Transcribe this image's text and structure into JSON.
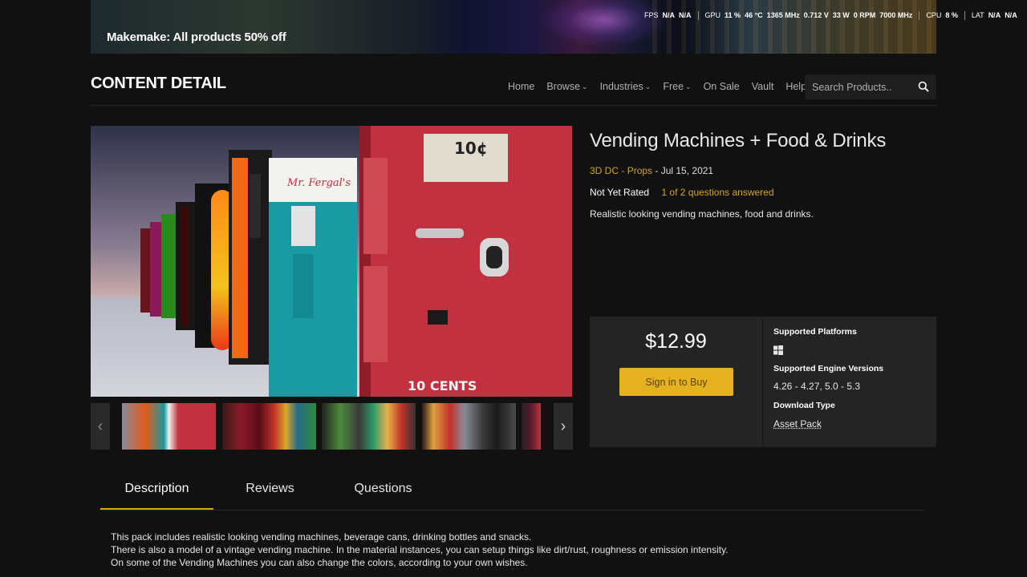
{
  "banner": {
    "text": "Makemake: All products 50% off"
  },
  "perf": {
    "fps_label": "FPS",
    "fps_v1": "N/A",
    "fps_v2": "N/A",
    "gpu_label": "GPU",
    "gpu_usage": "11 %",
    "gpu_temp": "46 °C",
    "gpu_clock": "1365 MHz",
    "gpu_voltage": "0.712 V",
    "gpu_power": "33 W",
    "gpu_fan": "0 RPM",
    "gpu_mem": "7000 MHz",
    "cpu_label": "CPU",
    "cpu_usage": "8 %",
    "lat_label": "LAT",
    "lat_v1": "N/A",
    "lat_v2": "N/A"
  },
  "header": {
    "title": "CONTENT DETAIL",
    "nav": [
      "Home",
      "Browse",
      "Industries",
      "Free",
      "On Sale",
      "Vault",
      "Help"
    ],
    "search_placeholder": "Search Products.."
  },
  "product": {
    "title": "Vending Machines + Food & Drinks",
    "seller": "3D DC",
    "separator": " - ",
    "category": "Props",
    "date": " - Jul 15, 2021",
    "rating": "Not Yet Rated",
    "questions": "1 of 2 questions answered",
    "short_description": "Realistic looking vending machines, food and drinks."
  },
  "buybox": {
    "price": "$12.99",
    "buy_label": "Sign in to Buy",
    "platforms_label": "Supported Platforms",
    "engine_label": "Supported Engine Versions",
    "engine_versions": "4.26 - 4.27, 5.0 - 5.3",
    "download_label": "Download Type",
    "download_type": "Asset Pack"
  },
  "gallery": {
    "main_sign": "10¢",
    "brand_script": "Mr. Fergal's",
    "cents_text": "10 CENTS"
  },
  "tabs": [
    "Description",
    "Reviews",
    "Questions"
  ],
  "description": [
    "This pack includes realistic looking vending machines, beverage cans, drinking bottles and snacks.",
    "There is also a model of a vintage vending machine. In the material instances, you can setup things like dirt/rust, roughness or emission intensity.",
    "On some of the Vending Machines you can also change the colors, according to your own wishes."
  ],
  "colors": {
    "accent": "#d4a418",
    "button": "#e6b11f",
    "background": "#111111",
    "panel": "#242424"
  }
}
